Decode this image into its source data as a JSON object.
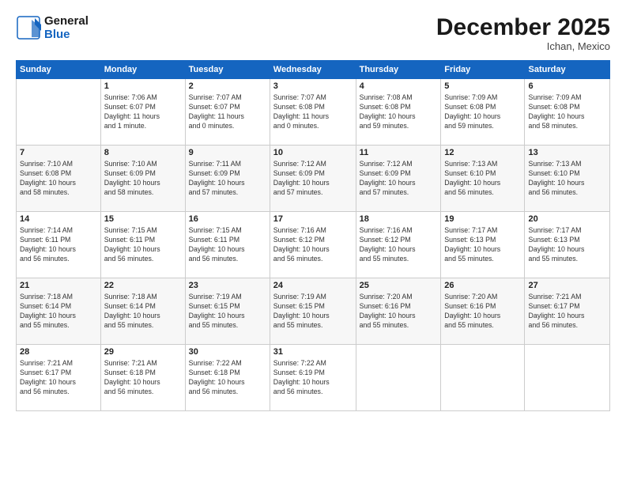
{
  "header": {
    "logo_general": "General",
    "logo_blue": "Blue",
    "title": "December 2025",
    "location": "Ichan, Mexico"
  },
  "weekdays": [
    "Sunday",
    "Monday",
    "Tuesday",
    "Wednesday",
    "Thursday",
    "Friday",
    "Saturday"
  ],
  "weeks": [
    [
      {
        "day": "",
        "content": ""
      },
      {
        "day": "1",
        "content": "Sunrise: 7:06 AM\nSunset: 6:07 PM\nDaylight: 11 hours\nand 1 minute."
      },
      {
        "day": "2",
        "content": "Sunrise: 7:07 AM\nSunset: 6:07 PM\nDaylight: 11 hours\nand 0 minutes."
      },
      {
        "day": "3",
        "content": "Sunrise: 7:07 AM\nSunset: 6:08 PM\nDaylight: 11 hours\nand 0 minutes."
      },
      {
        "day": "4",
        "content": "Sunrise: 7:08 AM\nSunset: 6:08 PM\nDaylight: 10 hours\nand 59 minutes."
      },
      {
        "day": "5",
        "content": "Sunrise: 7:09 AM\nSunset: 6:08 PM\nDaylight: 10 hours\nand 59 minutes."
      },
      {
        "day": "6",
        "content": "Sunrise: 7:09 AM\nSunset: 6:08 PM\nDaylight: 10 hours\nand 58 minutes."
      }
    ],
    [
      {
        "day": "7",
        "content": "Sunrise: 7:10 AM\nSunset: 6:08 PM\nDaylight: 10 hours\nand 58 minutes."
      },
      {
        "day": "8",
        "content": "Sunrise: 7:10 AM\nSunset: 6:09 PM\nDaylight: 10 hours\nand 58 minutes."
      },
      {
        "day": "9",
        "content": "Sunrise: 7:11 AM\nSunset: 6:09 PM\nDaylight: 10 hours\nand 57 minutes."
      },
      {
        "day": "10",
        "content": "Sunrise: 7:12 AM\nSunset: 6:09 PM\nDaylight: 10 hours\nand 57 minutes."
      },
      {
        "day": "11",
        "content": "Sunrise: 7:12 AM\nSunset: 6:09 PM\nDaylight: 10 hours\nand 57 minutes."
      },
      {
        "day": "12",
        "content": "Sunrise: 7:13 AM\nSunset: 6:10 PM\nDaylight: 10 hours\nand 56 minutes."
      },
      {
        "day": "13",
        "content": "Sunrise: 7:13 AM\nSunset: 6:10 PM\nDaylight: 10 hours\nand 56 minutes."
      }
    ],
    [
      {
        "day": "14",
        "content": "Sunrise: 7:14 AM\nSunset: 6:11 PM\nDaylight: 10 hours\nand 56 minutes."
      },
      {
        "day": "15",
        "content": "Sunrise: 7:15 AM\nSunset: 6:11 PM\nDaylight: 10 hours\nand 56 minutes."
      },
      {
        "day": "16",
        "content": "Sunrise: 7:15 AM\nSunset: 6:11 PM\nDaylight: 10 hours\nand 56 minutes."
      },
      {
        "day": "17",
        "content": "Sunrise: 7:16 AM\nSunset: 6:12 PM\nDaylight: 10 hours\nand 56 minutes."
      },
      {
        "day": "18",
        "content": "Sunrise: 7:16 AM\nSunset: 6:12 PM\nDaylight: 10 hours\nand 55 minutes."
      },
      {
        "day": "19",
        "content": "Sunrise: 7:17 AM\nSunset: 6:13 PM\nDaylight: 10 hours\nand 55 minutes."
      },
      {
        "day": "20",
        "content": "Sunrise: 7:17 AM\nSunset: 6:13 PM\nDaylight: 10 hours\nand 55 minutes."
      }
    ],
    [
      {
        "day": "21",
        "content": "Sunrise: 7:18 AM\nSunset: 6:14 PM\nDaylight: 10 hours\nand 55 minutes."
      },
      {
        "day": "22",
        "content": "Sunrise: 7:18 AM\nSunset: 6:14 PM\nDaylight: 10 hours\nand 55 minutes."
      },
      {
        "day": "23",
        "content": "Sunrise: 7:19 AM\nSunset: 6:15 PM\nDaylight: 10 hours\nand 55 minutes."
      },
      {
        "day": "24",
        "content": "Sunrise: 7:19 AM\nSunset: 6:15 PM\nDaylight: 10 hours\nand 55 minutes."
      },
      {
        "day": "25",
        "content": "Sunrise: 7:20 AM\nSunset: 6:16 PM\nDaylight: 10 hours\nand 55 minutes."
      },
      {
        "day": "26",
        "content": "Sunrise: 7:20 AM\nSunset: 6:16 PM\nDaylight: 10 hours\nand 55 minutes."
      },
      {
        "day": "27",
        "content": "Sunrise: 7:21 AM\nSunset: 6:17 PM\nDaylight: 10 hours\nand 56 minutes."
      }
    ],
    [
      {
        "day": "28",
        "content": "Sunrise: 7:21 AM\nSunset: 6:17 PM\nDaylight: 10 hours\nand 56 minutes."
      },
      {
        "day": "29",
        "content": "Sunrise: 7:21 AM\nSunset: 6:18 PM\nDaylight: 10 hours\nand 56 minutes."
      },
      {
        "day": "30",
        "content": "Sunrise: 7:22 AM\nSunset: 6:18 PM\nDaylight: 10 hours\nand 56 minutes."
      },
      {
        "day": "31",
        "content": "Sunrise: 7:22 AM\nSunset: 6:19 PM\nDaylight: 10 hours\nand 56 minutes."
      },
      {
        "day": "",
        "content": ""
      },
      {
        "day": "",
        "content": ""
      },
      {
        "day": "",
        "content": ""
      }
    ]
  ]
}
